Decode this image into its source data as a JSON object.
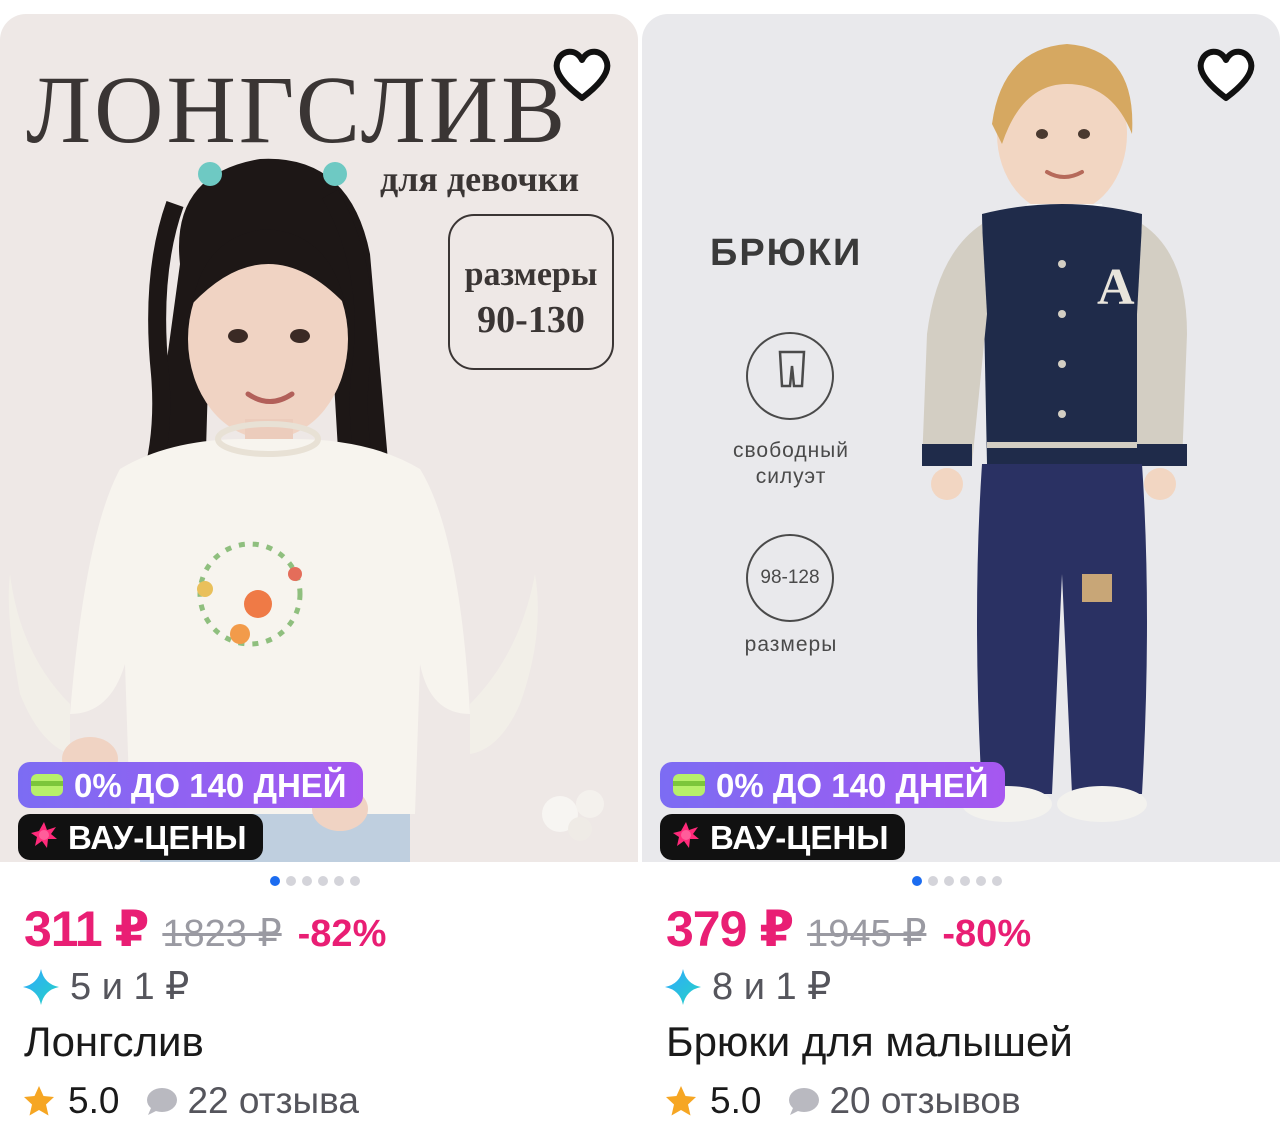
{
  "products": [
    {
      "promo": {
        "title": "ЛОНГСЛИВ",
        "subtitle": "для девочки",
        "sizes_label": "размеры",
        "sizes_range": "90-130"
      },
      "badges": {
        "credit": "0% ДО 140 ДНЕЙ",
        "wow": "ВАУ-ЦЕНЫ"
      },
      "price": "311 ₽",
      "old_price": "1823 ₽",
      "discount": "-82%",
      "bonus": "5 и 1 ₽",
      "title": "Лонгслив",
      "rating": "5.0",
      "reviews": "22 отзыва",
      "carousel_dots": 6,
      "active_dot": 0
    },
    {
      "promo": {
        "title": "БРЮКИ",
        "fit_caption_1": "свободный",
        "fit_caption_2": "силуэт",
        "sizes_range": "98-128",
        "sizes_label": "размеры"
      },
      "badges": {
        "credit": "0% ДО 140 ДНЕЙ",
        "wow": "ВАУ-ЦЕНЫ"
      },
      "price": "379 ₽",
      "old_price": "1945 ₽",
      "discount": "-80%",
      "bonus": "8 и 1 ₽",
      "title": "Брюки для малышей",
      "rating": "5.0",
      "reviews": "20 отзывов",
      "carousel_dots": 6,
      "active_dot": 0
    }
  ],
  "icons": {
    "favorite": "heart-outline-icon",
    "credit": "card-icon",
    "wow": "burst-icon",
    "bonus": "sparkle-icon",
    "rating": "star-icon",
    "reviews": "chat-bubble-icon"
  },
  "colors": {
    "price_accent": "#e91e74",
    "credit_badge": "#8b5cf6",
    "wow_badge": "#111111",
    "star": "#f6a623",
    "dot_active": "#1c6cf0"
  }
}
